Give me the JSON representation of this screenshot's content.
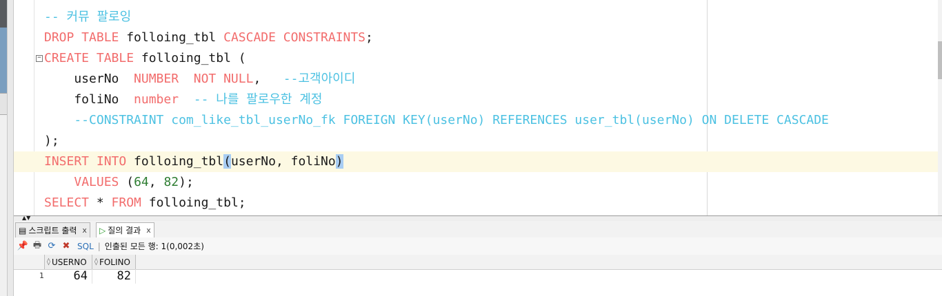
{
  "editor": {
    "lines": [
      [
        {
          "t": "-- 커뮤 팔로잉",
          "c": "cm"
        }
      ],
      [
        {
          "t": "DROP TABLE ",
          "c": "kw"
        },
        {
          "t": "folloing_tbl "
        },
        {
          "t": "CASCADE CONSTRAINTS",
          "c": "kw"
        },
        {
          "t": ";"
        }
      ],
      [
        {
          "t": "CREATE TABLE ",
          "c": "kw"
        },
        {
          "t": "folloing_tbl ("
        }
      ],
      [
        {
          "t": "    userNo  "
        },
        {
          "t": "NUMBER  NOT NULL",
          "c": "kw"
        },
        {
          "t": ",   "
        },
        {
          "t": "--고객아이디",
          "c": "cm"
        }
      ],
      [
        {
          "t": "    foliNo  "
        },
        {
          "t": "number",
          "c": "kw"
        },
        {
          "t": "  "
        },
        {
          "t": "-- 나를 팔로우한 계정",
          "c": "cm"
        }
      ],
      [
        {
          "t": "    --CONSTRAINT com_like_tbl_userNo_fk FOREIGN KEY(userNo) REFERENCES user_tbl(userNo) ON DELETE CASCADE",
          "c": "cm"
        }
      ],
      [
        {
          "t": ");"
        }
      ],
      [
        {
          "t": "INSERT INTO ",
          "c": "kw"
        },
        {
          "t": "folloing_tbl"
        },
        {
          "t": "(",
          "c": "br"
        },
        {
          "t": "userNo, foliNo"
        },
        {
          "t": ")",
          "c": "br"
        }
      ],
      [
        {
          "t": "    "
        },
        {
          "t": "VALUES ",
          "c": "kw"
        },
        {
          "t": "("
        },
        {
          "t": "64",
          "c": "num"
        },
        {
          "t": ", "
        },
        {
          "t": "82",
          "c": "num"
        },
        {
          "t": ");"
        }
      ],
      [
        {
          "t": "SELECT ",
          "c": "kw"
        },
        {
          "t": "* "
        },
        {
          "t": "FROM ",
          "c": "kw"
        },
        {
          "t": "folloing_tbl;"
        }
      ]
    ],
    "highlighted_line": 7
  },
  "tabs": [
    {
      "label": "스크립트 출력",
      "close": "x",
      "icon": "script-output-icon"
    },
    {
      "label": "질의 결과",
      "close": "x",
      "icon": "run-query-icon"
    }
  ],
  "toolbar": {
    "sql_label": "SQL",
    "separator": "|",
    "status": "인출된 모든 행: 1(0,002초)"
  },
  "grid": {
    "columns": [
      "USERNO",
      "FOLINO"
    ],
    "rows": [
      {
        "num": "1",
        "cells": [
          "64",
          "82"
        ]
      }
    ]
  },
  "colors": {
    "keyword": "#f26c6c",
    "comment": "#4cc1e2",
    "number": "#2e7d32",
    "current_line": "#fdf9e3",
    "bracket_match": "#a8cdf3"
  }
}
